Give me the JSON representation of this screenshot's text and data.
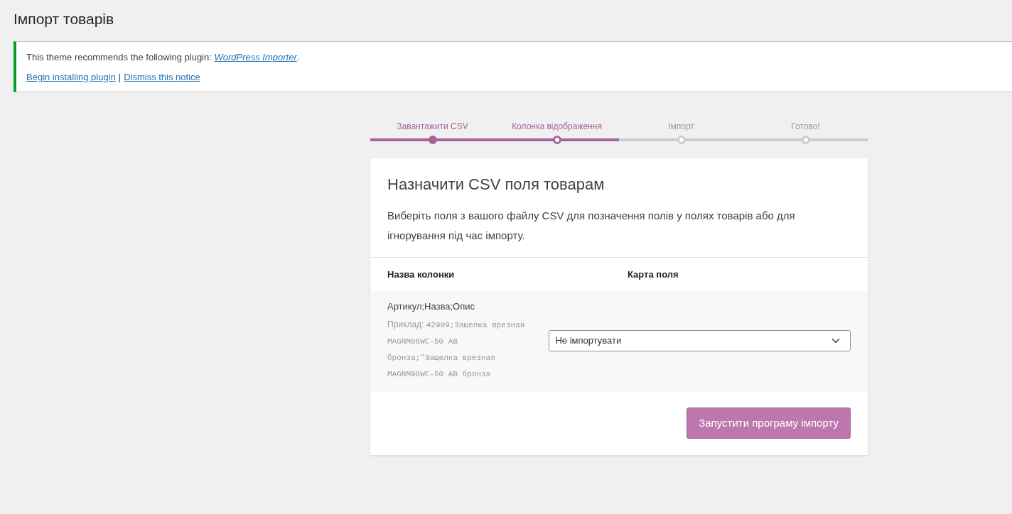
{
  "page_title": "Імпорт товарів",
  "notice": {
    "text": "This theme recommends the following plugin: ",
    "plugin_link": "WordPress Importer",
    "text_end": ".",
    "links": [
      "Begin installing plugin",
      "Dismiss this notice"
    ],
    "separator": "|"
  },
  "steps": [
    {
      "label": "Завантажити CSV",
      "done": true,
      "active": false
    },
    {
      "label": "Колонка відображення",
      "done": false,
      "active": true
    },
    {
      "label": "Імпорт",
      "done": false,
      "active": false
    },
    {
      "label": "Готово!",
      "done": false,
      "active": false
    }
  ],
  "card": {
    "title": "Назначити CSV поля товарам",
    "description": "Виберіть поля з вашого файлу CSV для позначення полів у полях товарів або для ігнорування під час імпорту.",
    "columns": [
      "Назва колонки",
      "Карта поля"
    ],
    "rows": [
      {
        "name": "Артикул;Назва;Опис",
        "example_label": "Приклад:",
        "example": "42909;Защелка врезная MAGNM96WC-50 AB бронза;\"Защелка врезная MAGNM96WC-50 AB бронза",
        "mapping": "Не імпортувати"
      }
    ],
    "button": "Запустити програму імпорту"
  }
}
